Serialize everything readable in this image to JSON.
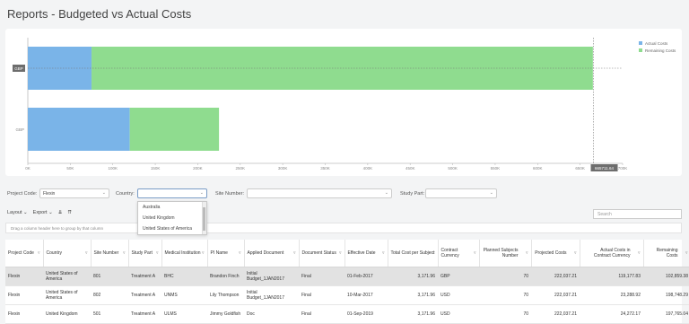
{
  "page": {
    "title": "Reports - Budgeted vs Actual Costs"
  },
  "chart_data": {
    "type": "bar",
    "orientation": "horizontal",
    "stacked": true,
    "categories": [
      "GBP",
      "GBP"
    ],
    "series": [
      {
        "name": "Actual Costs",
        "color": "#7ab4e8",
        "values": [
          75000,
          120000
        ]
      },
      {
        "name": "Remaining Costs",
        "color": "#8fdc8f",
        "values": [
          590000,
          105000
        ]
      }
    ],
    "xlim": [
      0,
      700000
    ],
    "xticks": [
      "0K",
      "50K",
      "100K",
      "150K",
      "200K",
      "250K",
      "300K",
      "350K",
      "400K",
      "450K",
      "500K",
      "550K",
      "600K",
      "650K",
      "700K"
    ],
    "crosshair_x_label": "665711.64",
    "crosshair_y_label": "GBP",
    "legend_position": "top-right"
  },
  "filters": {
    "project_code_label": "Project Code:",
    "project_code_value": "Flexin",
    "country_label": "Country:",
    "country_value": "",
    "country_options": [
      "Australia",
      "United Kingdom",
      "United States of America"
    ],
    "site_number_label": "Site Number:",
    "study_part_label": "Study Part:"
  },
  "toolbar": {
    "layout": "Layout",
    "export": "Export",
    "search_placeholder": "Search"
  },
  "group_hint": "Drag a column header here to group by that column",
  "table": {
    "headers": [
      "Project Code",
      "Country",
      "Site Number",
      "Study Part",
      "Medical Institution",
      "PI Name",
      "Applied Document",
      "Document Status",
      "Effective Date",
      "Total Cost per Subject",
      "Contract Currency",
      "Planned Subjects Number",
      "Projected Costs",
      "Actual Costs in Contract Currency",
      "Remaining Costs"
    ],
    "rows": [
      [
        "Flexin",
        "United States of America",
        "801",
        "Treatment A",
        "BHC",
        "Brandon Finch",
        "Initial Budget_1JAN2017",
        "Final",
        "01-Feb-2017",
        "3,171.96",
        "GBP",
        "70",
        "222,037.21",
        "119,177.83",
        "102,859.38"
      ],
      [
        "Flexin",
        "United States of America",
        "802",
        "Treatment A",
        "UNMS",
        "Lily Thompson",
        "Initial Budget_1JAN2017",
        "Final",
        "10-Mar-2017",
        "3,171.96",
        "USD",
        "70",
        "222,037.21",
        "23,288.92",
        "198,748.29"
      ],
      [
        "Flexin",
        "United Kingdom",
        "501",
        "Treatment A",
        "ULMS",
        "Jimmy Goldfish",
        "Doc",
        "Final",
        "01-Sep-2019",
        "3,171.96",
        "USD",
        "70",
        "222,037.21",
        "24,272.17",
        "197,765.04"
      ]
    ]
  }
}
